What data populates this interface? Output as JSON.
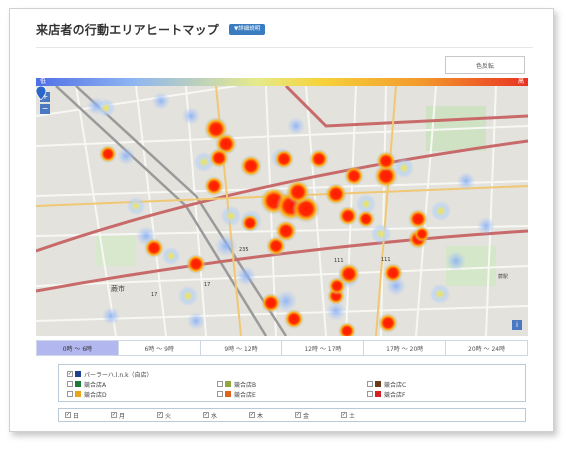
{
  "page": {
    "title": "来店者の行動エリアヒートマップ",
    "detail_button": "▼詳細説明",
    "view_button": "色反転"
  },
  "gradient": {
    "left_label": "低",
    "right_label": "高"
  },
  "map": {
    "zoom_in": "+",
    "zoom_out": "−",
    "info": "i",
    "place_labels": [
      "蕨市",
      "蕨駅"
    ],
    "road_numbers": [
      "17",
      "235",
      "111",
      "111",
      "17"
    ]
  },
  "tabs": [
    {
      "label": "0時 〜 6時",
      "active": true
    },
    {
      "label": "6時 〜 9時",
      "active": false
    },
    {
      "label": "9時 〜 12時",
      "active": false
    },
    {
      "label": "12時 〜 17時",
      "active": false
    },
    {
      "label": "17時 〜 20時",
      "active": false
    },
    {
      "label": "20時 〜 24時",
      "active": false
    }
  ],
  "legend": {
    "rows": [
      [
        {
          "label": "パーラーハ.l.n.k（自店）",
          "checked": true,
          "color": "#1f3f8f"
        }
      ],
      [
        {
          "label": "競合店A",
          "checked": false,
          "color": "#1f7a3a"
        },
        {
          "label": "競合店B",
          "checked": false,
          "color": "#8fa83a"
        },
        {
          "label": "競合店C",
          "checked": false,
          "color": "#6b3a1a"
        }
      ],
      [
        {
          "label": "競合店D",
          "checked": false,
          "color": "#e9a51a"
        },
        {
          "label": "競合店E",
          "checked": false,
          "color": "#e0611a"
        },
        {
          "label": "競合店F",
          "checked": false,
          "color": "#d81f1f"
        }
      ]
    ]
  },
  "days": [
    {
      "label": "日",
      "checked": true
    },
    {
      "label": "月",
      "checked": true
    },
    {
      "label": "火",
      "checked": true
    },
    {
      "label": "水",
      "checked": true
    },
    {
      "label": "木",
      "checked": true
    },
    {
      "label": "金",
      "checked": true
    },
    {
      "label": "土",
      "checked": true
    }
  ]
}
